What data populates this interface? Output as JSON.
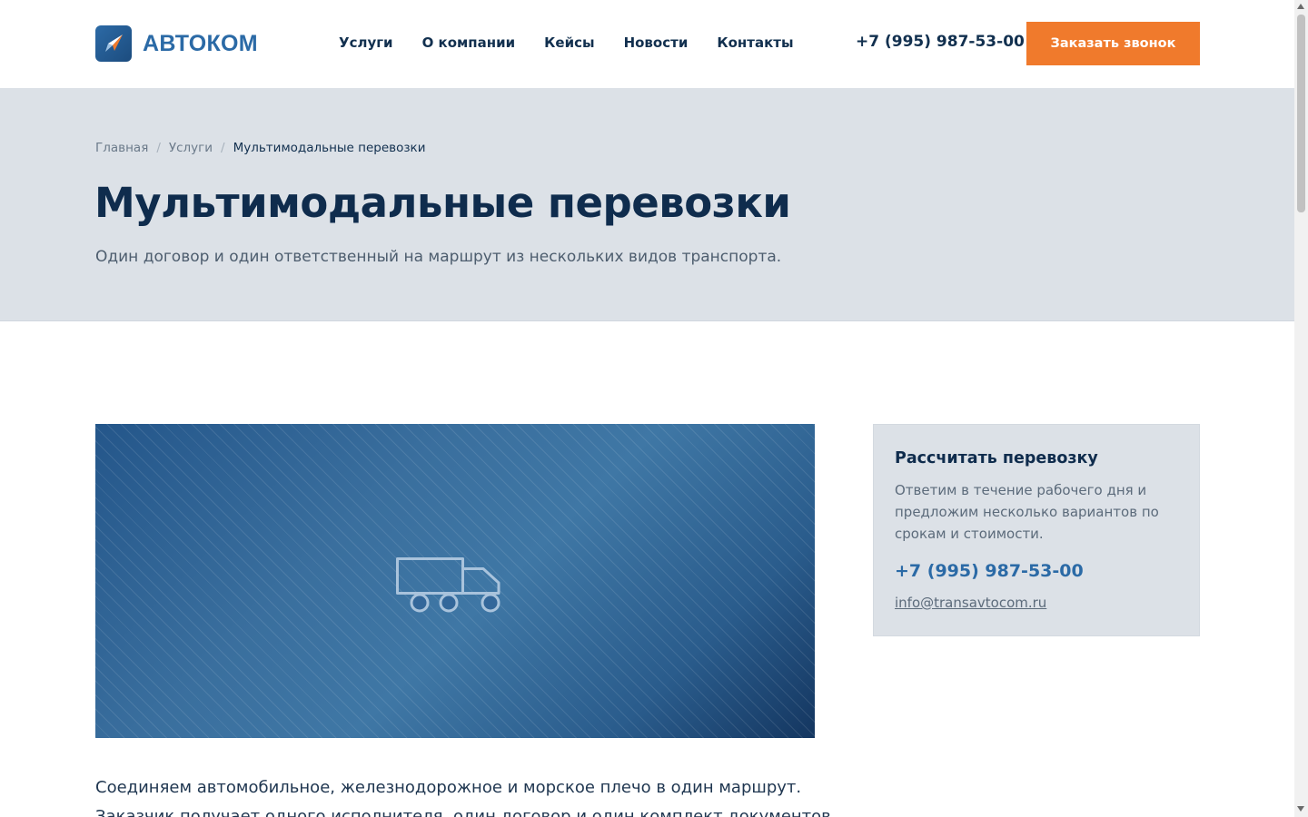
{
  "header": {
    "logo_text": "АВТОКОМ",
    "logo_icon": "paper-plane-icon",
    "nav": [
      {
        "label": "Услуги"
      },
      {
        "label": "О компании"
      },
      {
        "label": "Кейсы"
      },
      {
        "label": "Новости"
      },
      {
        "label": "Контакты"
      }
    ],
    "phone": "+7 (995) 987-53-00",
    "cta_label": "Заказать звонок"
  },
  "hero": {
    "breadcrumb": [
      {
        "label": "Главная"
      },
      {
        "label": "Услуги"
      },
      {
        "label": "Мультимодальные перевозки"
      }
    ],
    "breadcrumb_separator": "/",
    "title": "Мультимодальные перевозки",
    "lead": "Один договор и один ответственный на маршрут из нескольких видов транспорта."
  },
  "media": {
    "icon": "truck-icon"
  },
  "sidebar_card": {
    "title": "Рассчитать перевозку",
    "text": "Ответим в течение рабочего дня и предложим несколько вариантов по срокам и стоимости.",
    "phone": "+7 (995) 987-53-00",
    "email": "info@transavtocom.ru"
  },
  "content": {
    "paragraph_1": "Соединяем автомобильное, железнодорожное и морское плечо в один маршрут.",
    "paragraph_2": "Заказчик получает одного исполнителя, один договор и один комплект документов."
  },
  "colors": {
    "brand_blue": "#2b6aa6",
    "dark_navy": "#0f2c4d",
    "accent_orange": "#f07a2c",
    "panel_gray": "#dce1e7"
  }
}
